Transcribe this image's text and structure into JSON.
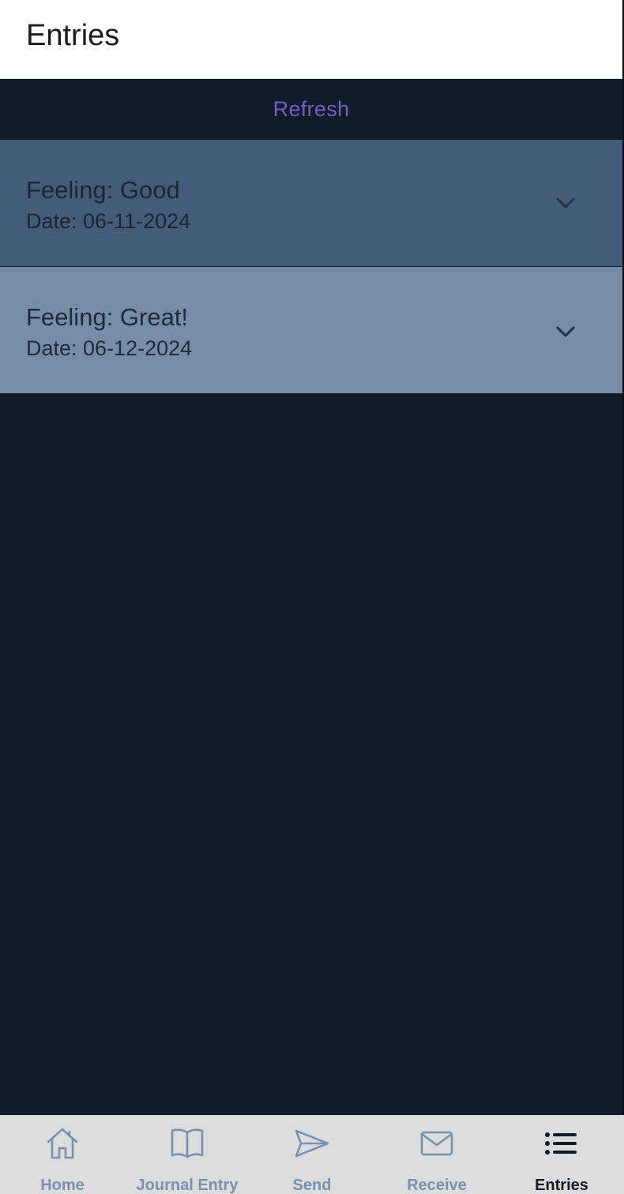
{
  "header": {
    "title": "Entries"
  },
  "refresh": {
    "label": "Refresh"
  },
  "entries": [
    {
      "feeling": "Feeling: Good",
      "date": "Date: 06-11-2024"
    },
    {
      "feeling": "Feeling: Great!",
      "date": "Date: 06-12-2024"
    }
  ],
  "nav": {
    "items": [
      {
        "label": "Home",
        "icon": "home-icon"
      },
      {
        "label": "Journal Entry",
        "icon": "book-icon"
      },
      {
        "label": "Send",
        "icon": "send-icon"
      },
      {
        "label": "Receive",
        "icon": "mail-icon"
      },
      {
        "label": "Entries",
        "icon": "list-icon"
      }
    ],
    "active": "Entries"
  },
  "colors": {
    "background": "#111c2b",
    "accent": "#7a5cc4",
    "entry_1_bg": "#435c7a",
    "entry_2_bg": "#778ca9",
    "nav_inactive": "#7990b0",
    "nav_active": "#111c2b"
  }
}
